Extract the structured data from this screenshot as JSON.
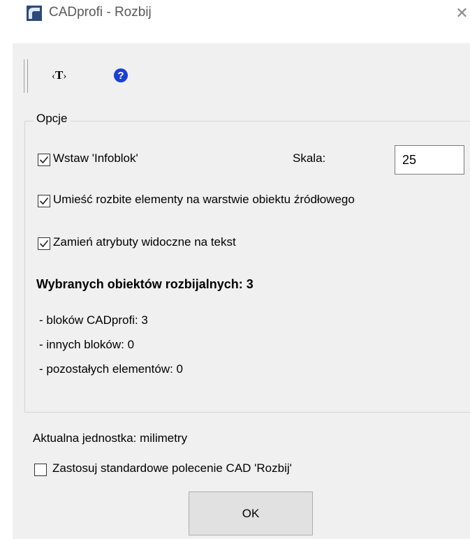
{
  "window": {
    "title": "CADprofi - Rozbij",
    "close_glyph": "✕"
  },
  "toolbar": {
    "text_button_label": "T",
    "icons": [
      "toolbar-grip",
      "text-tag-icon",
      "help-icon"
    ]
  },
  "options_group": {
    "label": "Opcje",
    "insert_infoblock": {
      "label": "Wstaw 'Infoblok'",
      "checked": true
    },
    "scale": {
      "label": "Skala:",
      "value": "25"
    },
    "place_on_source_layer": {
      "label": "Umieść rozbite elementy na warstwie obiektu źródłowego",
      "checked": true
    },
    "convert_attributes": {
      "label": "Zamień atrybuty widoczne na tekst",
      "checked": true
    },
    "selected_summary": "Wybranych obiektów rozbijalnych: 3",
    "breakdown": [
      "- bloków CADprofi: 3",
      "- innych bloków: 0",
      "- pozostałych elementów: 0"
    ]
  },
  "current_unit": "Aktualna jednostka: milimetry",
  "use_standard_command": {
    "label": "Zastosuj standardowe polecenie CAD 'Rozbij'",
    "checked": false
  },
  "ok_label": "OK",
  "colors": {
    "dialog_bg": "#f0f0f0",
    "help_icon_blue": "#1a3fd6",
    "app_icon_blue": "#2b4a7a"
  }
}
